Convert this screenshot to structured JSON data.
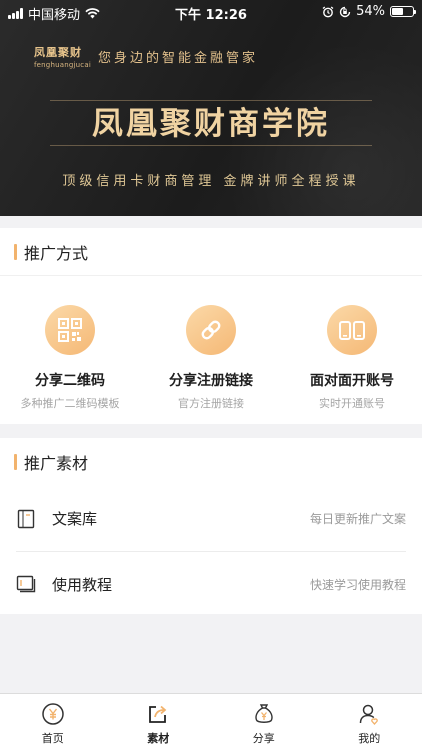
{
  "status_bar": {
    "carrier": "中国移动",
    "time": "下午 12:26",
    "battery": "54%",
    "battery_level": 0.54
  },
  "banner": {
    "brand_cn": "凤凰聚财",
    "brand_en": "fenghuangjucai",
    "slogan": "您身边的智能金融管家",
    "title": "凤凰聚财商学院",
    "subtitle": "顶级信用卡财商管理   金牌讲师全程授课"
  },
  "promotion": {
    "title": "推广方式",
    "items": [
      {
        "label": "分享二维码",
        "desc": "多种推广二维码模板",
        "icon": "qrcode-icon"
      },
      {
        "label": "分享注册链接",
        "desc": "官方注册链接",
        "icon": "link-icon"
      },
      {
        "label": "面对面开账号",
        "desc": "实时开通账号",
        "icon": "phones-icon"
      }
    ]
  },
  "materials": {
    "title": "推广素材",
    "items": [
      {
        "label": "文案库",
        "desc": "每日更新推广文案",
        "icon": "document-icon"
      },
      {
        "label": "使用教程",
        "desc": "快速学习使用教程",
        "icon": "book-icon"
      }
    ]
  },
  "tabbar": {
    "active_color": "#222222",
    "tabs": [
      {
        "label": "首页",
        "icon": "yuan-coin-icon"
      },
      {
        "label": "素材",
        "icon": "share-box-icon",
        "active": true
      },
      {
        "label": "分享",
        "icon": "money-bag-icon"
      },
      {
        "label": "我的",
        "icon": "user-icon"
      }
    ]
  },
  "colors": {
    "accent": "#f2b36d",
    "gold_text": "#f0d3a2",
    "banner_bg": "#222222"
  }
}
